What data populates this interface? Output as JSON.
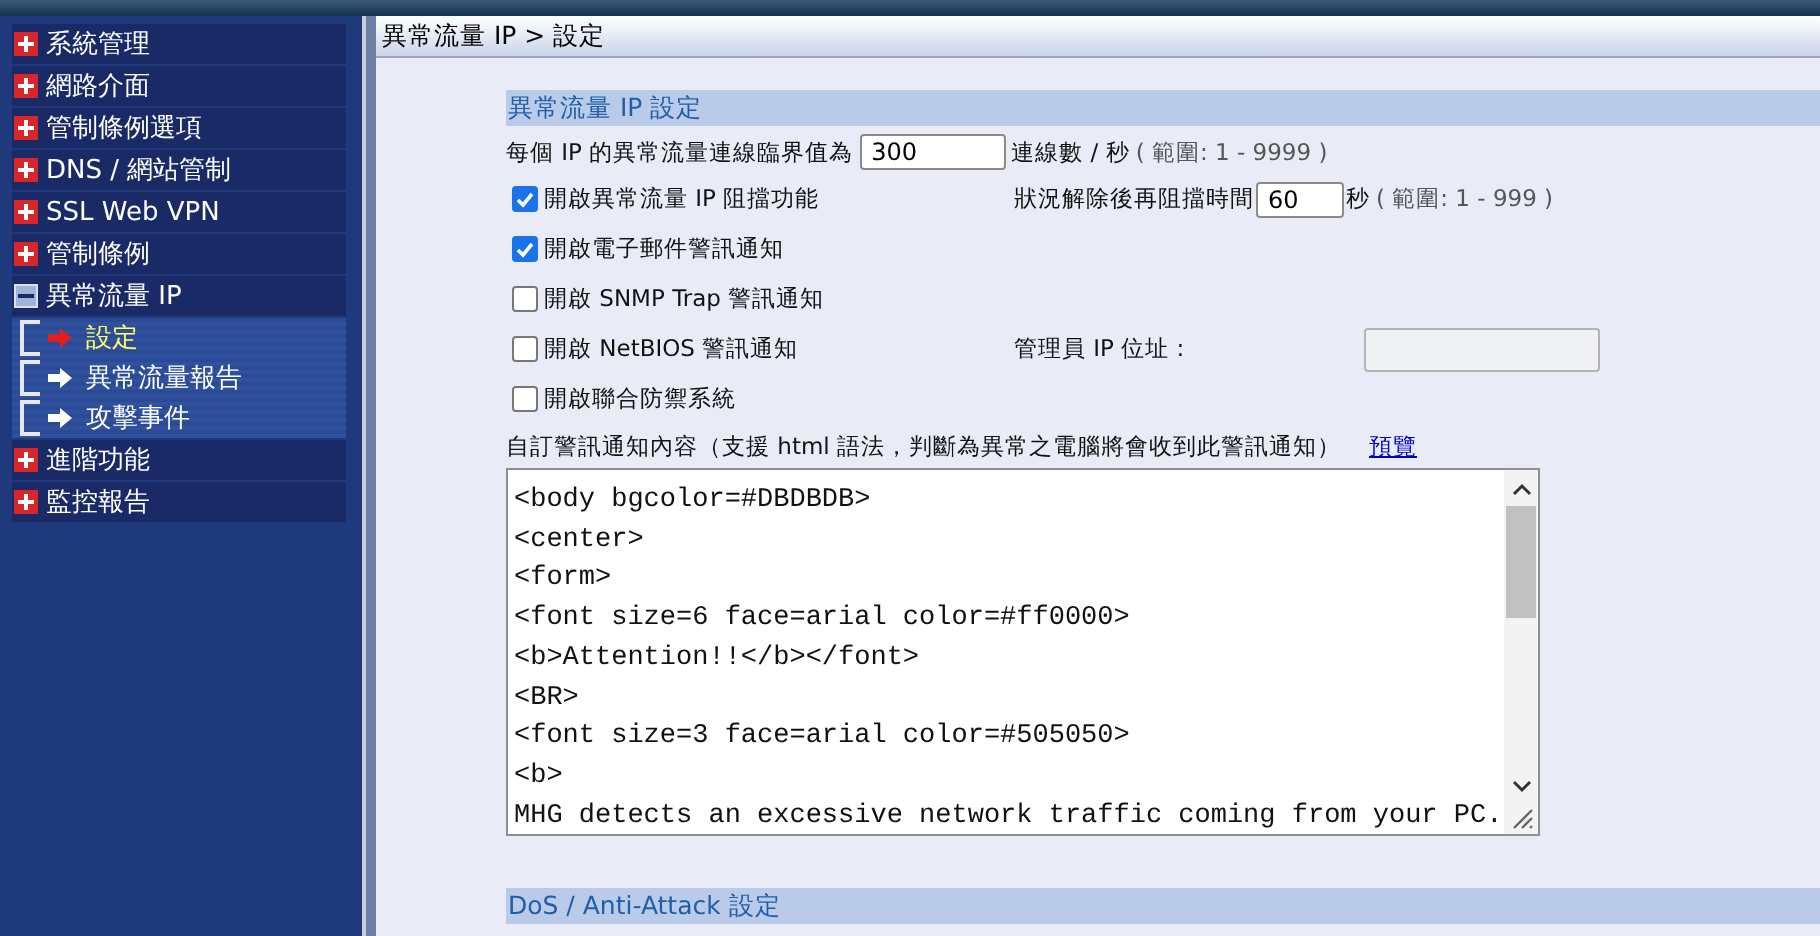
{
  "breadcrumb": "異常流量 IP > 設定",
  "sidebar": {
    "items": [
      {
        "label": "系統管理",
        "expanded": false
      },
      {
        "label": "網路介面",
        "expanded": false
      },
      {
        "label": "管制條例選項",
        "expanded": false
      },
      {
        "label": "DNS / 網站管制",
        "expanded": false
      },
      {
        "label": "SSL Web VPN",
        "expanded": false
      },
      {
        "label": "管制條例",
        "expanded": false
      },
      {
        "label": "異常流量 IP",
        "expanded": true,
        "children": [
          {
            "label": "設定",
            "selected": true
          },
          {
            "label": "異常流量報告",
            "selected": false
          },
          {
            "label": "攻擊事件",
            "selected": false
          }
        ]
      },
      {
        "label": "進階功能",
        "expanded": false
      },
      {
        "label": "監控報告",
        "expanded": false
      }
    ]
  },
  "alert_settings": {
    "title": "異常流量 IP 設定",
    "threshold": {
      "label": "每個 IP 的異常流量連線臨界值為",
      "value": "300",
      "unit": "連線數 / 秒",
      "range": "( 範圍: 1 - 9999 )"
    },
    "options": [
      {
        "label": "開啟異常流量 IP 阻擋功能",
        "checked": true,
        "side": {
          "kind": "timer",
          "label": "狀況解除後再阻擋時間",
          "value": "60",
          "unit": "秒",
          "range": "( 範圍: 1 - 999 )"
        }
      },
      {
        "label": "開啟電子郵件警訊通知",
        "checked": true
      },
      {
        "label": "開啟 SNMP Trap 警訊通知",
        "checked": false
      },
      {
        "label": "開啟 NetBIOS 警訊通知",
        "checked": false,
        "side": {
          "kind": "ip_field",
          "label": "管理員 IP 位址 :"
        }
      },
      {
        "label": "開啟聯合防禦系統",
        "checked": false
      }
    ],
    "message": {
      "label": "自訂警訊通知內容（支援 html 語法，判斷為異常之電腦將會收到此警訊通知）",
      "link": "預覽",
      "lines": [
        "<body bgcolor=#DBDBDB>",
        "<center>",
        "<form>",
        "<font size=6 face=arial color=#ff0000>",
        "<b>Attention!!</b></font>",
        "<BR>",
        "<font size=3 face=arial color=#505050>",
        "<b>",
        "MHG detects an excessive network traffic coming from your PC."
      ]
    }
  },
  "dos": {
    "title": "DoS / Anti-Attack 設定"
  }
}
